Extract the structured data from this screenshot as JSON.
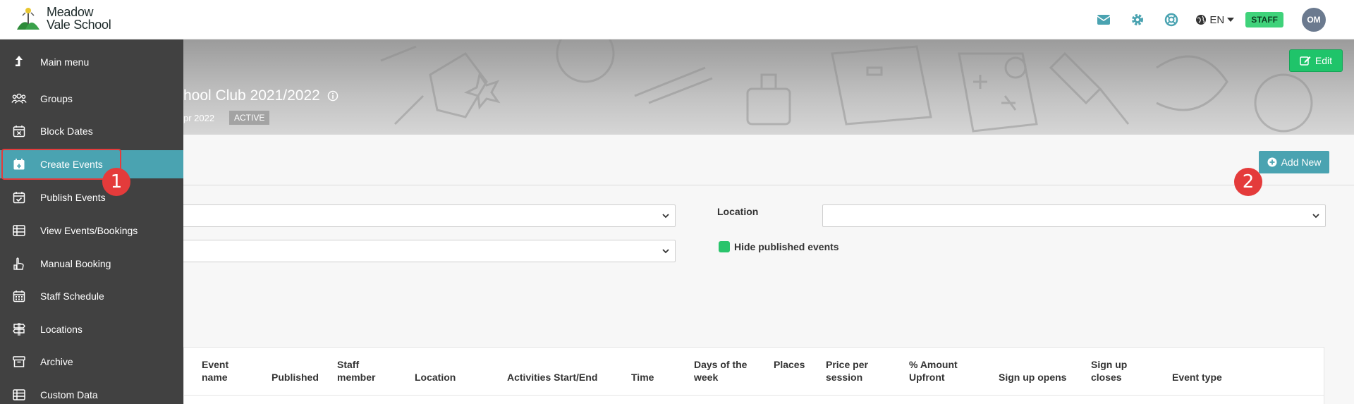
{
  "header": {
    "logo_line1": "Meadow",
    "logo_line2": "Vale School",
    "lang": "EN",
    "role_badge": "STAFF",
    "avatar_initials": "OM",
    "icons": [
      "mail-icon",
      "gear-icon",
      "help-lifebuoy-icon",
      "globe-icon"
    ]
  },
  "banner": {
    "title": "hool Club 2021/2022",
    "date_fragment": "pr 2022",
    "status": "ACTIVE",
    "edit_label": "Edit"
  },
  "main": {
    "add_new_label": "Add New",
    "location_label": "Location",
    "hide_published_label": "Hide published events",
    "hide_published_checked": true
  },
  "table": {
    "columns": [
      {
        "line1": "Event",
        "line2": "name"
      },
      {
        "line1": "",
        "line2": "Published"
      },
      {
        "line1": "Staff",
        "line2": "member"
      },
      {
        "line1": "",
        "line2": "Location"
      },
      {
        "line1": "",
        "line2": "Activities Start/End"
      },
      {
        "line1": "",
        "line2": "Time"
      },
      {
        "line1": "Days of the",
        "line2": "week"
      },
      {
        "line1": "Places",
        "line2": ""
      },
      {
        "line1": "Price per",
        "line2": "session"
      },
      {
        "line1": "% Amount",
        "line2": "Upfront"
      },
      {
        "line1": "",
        "line2": "Sign up opens"
      },
      {
        "line1": "Sign up",
        "line2": "closes"
      },
      {
        "line1": "",
        "line2": "Event type"
      }
    ]
  },
  "sidebar": {
    "items": [
      {
        "label": "Main menu",
        "icon": "arrow-up-icon"
      },
      {
        "label": "Groups",
        "icon": "users-icon"
      },
      {
        "label": "Block Dates",
        "icon": "calendar-x-icon"
      },
      {
        "label": "Create Events",
        "icon": "calendar-plus-icon",
        "active": true
      },
      {
        "label": "Publish Events",
        "icon": "calendar-check-icon"
      },
      {
        "label": "View Events/Bookings",
        "icon": "table-icon"
      },
      {
        "label": "Manual Booking",
        "icon": "hand-pointer-icon"
      },
      {
        "label": "Staff Schedule",
        "icon": "calendar-grid-icon"
      },
      {
        "label": "Locations",
        "icon": "signpost-icon"
      },
      {
        "label": "Archive",
        "icon": "archive-box-icon"
      },
      {
        "label": "Custom Data",
        "icon": "table-icon"
      }
    ]
  },
  "annotations": {
    "step1": "1",
    "step2": "2",
    "accent_color": "#e43b3b"
  }
}
